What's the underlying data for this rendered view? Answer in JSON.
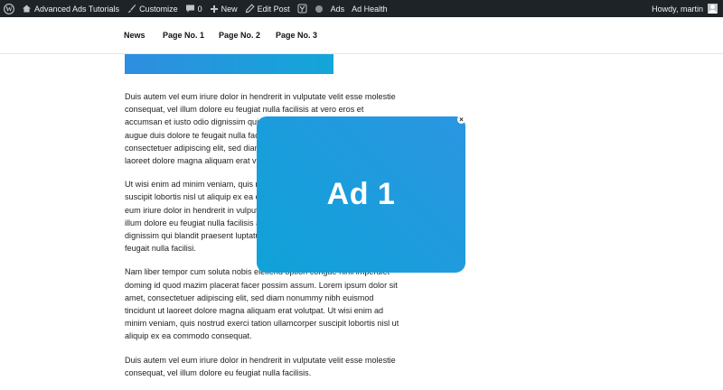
{
  "adminbar": {
    "icons": [
      "wordpress-logo-icon",
      "home-icon",
      "brush-icon",
      "comment-icon",
      "plus-icon",
      "pencil-icon",
      "yoast-icon",
      "status-dot-icon",
      "user-avatar-icon"
    ],
    "site_title": "Advanced Ads Tutorials",
    "customize": "Customize",
    "comments_count": "0",
    "new": "New",
    "edit_post": "Edit Post",
    "ads": "Ads",
    "ad_health": "Ad Health",
    "howdy": "Howdy, martin",
    "colors": {
      "bar_bg": "#1d2327",
      "bar_text": "#f0f0f1"
    }
  },
  "nav": {
    "items": [
      {
        "label": "News"
      },
      {
        "label": "Page No. 1"
      },
      {
        "label": "Page No. 2"
      },
      {
        "label": "Page No. 3"
      }
    ]
  },
  "content": {
    "paragraphs": [
      "Duis autem vel eum iriure dolor in hendrerit in vulputate velit esse molestie consequat, vel illum dolore eu feugiat nulla facilisis at vero eros et accumsan et iusto odio dignissim qui blandit praesent luptatum zzril delenit augue duis dolore te feugait nulla facilisi. Lorem ipsum dolor sit amet, consectetuer adipiscing elit, sed diam nonummy nibh euismod tincidunt ut laoreet dolore magna aliquam erat volutpat.",
      "Ut wisi enim ad minim veniam, quis nostrud exerci tation ullamcorper suscipit lobortis nisl ut aliquip ex ea commodo consequat. Duis autem vel eum iriure dolor in hendrerit in vulputate velit esse molestie consequat, vel illum dolore eu feugiat nulla facilisis at vero eros et accumsan et iusto odio dignissim qui blandit praesent luptatum zzril delenit augue duis dolore te feugait nulla facilisi.",
      "Nam liber tempor cum soluta nobis eleifend option congue nihil imperdiet doming id quod mazim placerat facer possim assum. Lorem ipsum dolor sit amet, consectetuer adipiscing elit, sed diam nonummy nibh euismod tincidunt ut laoreet dolore magna aliquam erat volutpat. Ut wisi enim ad minim veniam, quis nostrud exerci tation ullamcorper suscipit lobortis nisl ut aliquip ex ea commodo consequat.",
      "Duis autem vel eum iriure dolor in hendrerit in vulputate velit esse molestie consequat, vel illum dolore eu feugiat nulla facilisis."
    ]
  },
  "ad": {
    "label": "Ad 1",
    "close": "×",
    "colors": {
      "from": "#0fa2d8",
      "to": "#2b96e2"
    }
  }
}
